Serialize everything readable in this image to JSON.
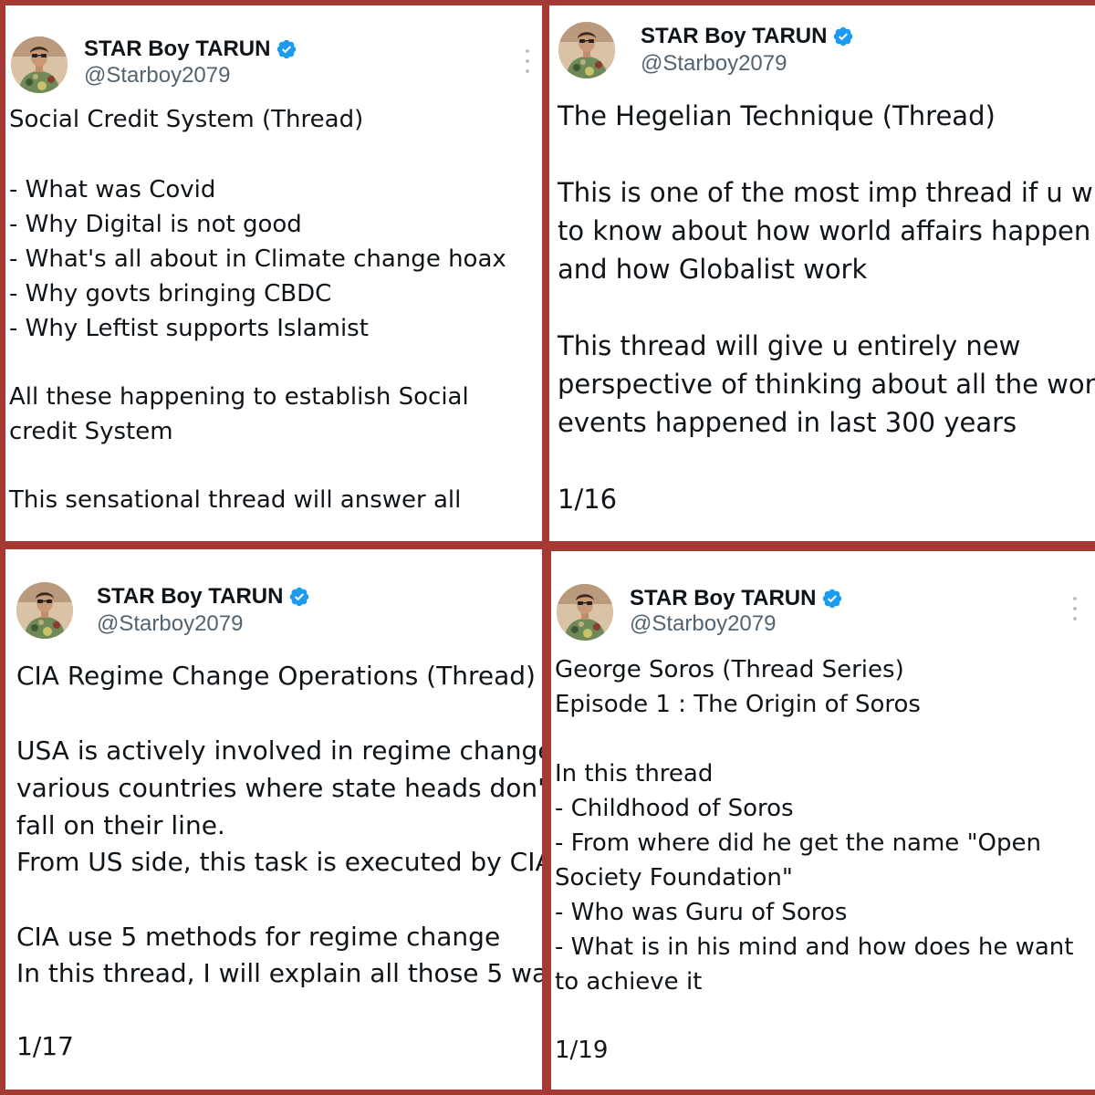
{
  "author": {
    "name": "STAR Boy TARUN",
    "handle": "@Starboy2079"
  },
  "posts": [
    {
      "lines": [
        "Social Credit System (Thread)",
        "- What was Covid",
        "- Why Digital is not good",
        "- What's all about in Climate change hoax",
        "- Why govts bringing CBDC",
        "- Why Leftist supports Islamist",
        "All these happening to establish Social",
        "credit System",
        "This sensational thread will answer all"
      ]
    },
    {
      "lines": [
        "The Hegelian Technique (Thread)",
        "This is one of the most imp thread if u w",
        "to know about how world affairs happen",
        "and how Globalist work",
        "This thread will give u entirely new",
        "perspective of thinking about all the wor",
        "events happened in last 300 years",
        "1/16"
      ]
    },
    {
      "lines": [
        "CIA Regime Change Operations (Thread)",
        "USA is actively involved in regime change",
        "various countries where state heads don'",
        "fall on their line.",
        "From US side, this task is executed by CIA",
        "CIA use 5 methods for regime change",
        "In this thread, I will explain all those 5 wa",
        "1/17"
      ]
    },
    {
      "lines": [
        "George Soros (Thread Series)",
        "Episode 1 : The Origin of Soros",
        "In this thread",
        "- Childhood of Soros",
        "- From where did he get the name \"Open",
        "Society Foundation\"",
        "- Who was Guru of Soros",
        "- What is in his mind and how does he want",
        "to achieve it",
        "1/19"
      ]
    }
  ],
  "colors": {
    "frame": "#a53a35",
    "verified": "#1d9bf0",
    "handle": "#536471",
    "text": "#0f1419"
  },
  "icons": {
    "verified": "verified-badge-icon",
    "more": "more-options-icon"
  }
}
